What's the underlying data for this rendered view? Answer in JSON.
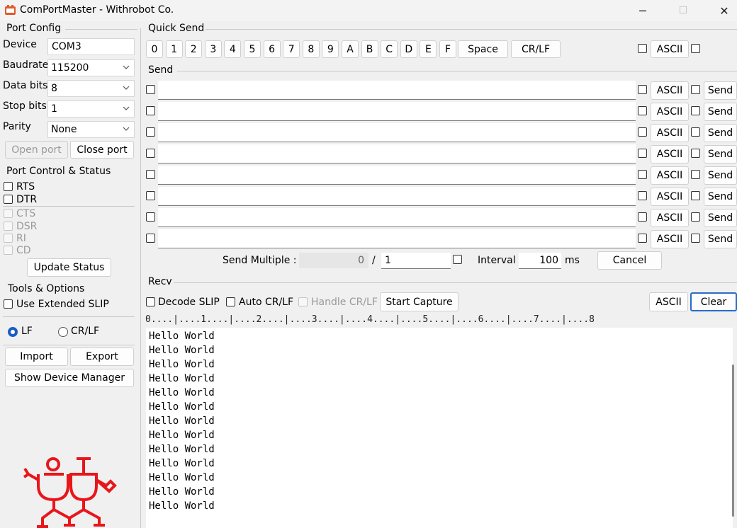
{
  "window": {
    "title": "ComPortMaster - Withrobot Co.",
    "buttons": {
      "minimize": "─",
      "maximize": "☐",
      "close": "✕"
    }
  },
  "port_config": {
    "title": "Port Config",
    "device_label": "Device",
    "device_value": "COM3",
    "baud_label": "Baudrate",
    "baud_value": "115200",
    "databits_label": "Data bits",
    "databits_value": "8",
    "stopbits_label": "Stop bits",
    "stopbits_value": "1",
    "parity_label": "Parity",
    "parity_value": "None",
    "open_label": "Open port",
    "close_label": "Close port"
  },
  "port_control": {
    "title": "Port Control & Status",
    "rts": "RTS",
    "dtr": "DTR",
    "cts": "CTS",
    "dsr": "DSR",
    "ri": "RI",
    "cd": "CD",
    "update": "Update Status"
  },
  "tools": {
    "title": "Tools & Options",
    "extended_slip": "Use Extended SLIP",
    "lf": "LF",
    "crlf": "CR/LF",
    "line_ending": "LF",
    "import": "Import",
    "export": "Export",
    "device_manager": "Show Device Manager"
  },
  "quick_send": {
    "title": "Quick Send",
    "keys": [
      "0",
      "1",
      "2",
      "3",
      "4",
      "5",
      "6",
      "7",
      "8",
      "9",
      "A",
      "B",
      "C",
      "D",
      "E",
      "F"
    ],
    "space": "Space",
    "crlf": "CR/LF",
    "ascii": "ASCII"
  },
  "send": {
    "title": "Send",
    "rows": [
      {
        "value": "",
        "ascii": "ASCII",
        "send": "Send"
      },
      {
        "value": "",
        "ascii": "ASCII",
        "send": "Send"
      },
      {
        "value": "",
        "ascii": "ASCII",
        "send": "Send"
      },
      {
        "value": "",
        "ascii": "ASCII",
        "send": "Send"
      },
      {
        "value": "",
        "ascii": "ASCII",
        "send": "Send"
      },
      {
        "value": "",
        "ascii": "ASCII",
        "send": "Send"
      },
      {
        "value": "",
        "ascii": "ASCII",
        "send": "Send"
      },
      {
        "value": "",
        "ascii": "ASCII",
        "send": "Send"
      }
    ],
    "multiple_label": "Send Multiple :",
    "multiple_count": "0",
    "slash": "/",
    "multiple_total": "1",
    "interval_label": "Interval",
    "interval_value": "100",
    "interval_unit": "ms",
    "cancel": "Cancel"
  },
  "recv": {
    "title": "Recv",
    "decode_slip": "Decode SLIP",
    "auto_crlf": "Auto CR/LF",
    "handle_crlf": "Handle CR/LF",
    "start_capture": "Start Capture",
    "ascii": "ASCII",
    "clear": "Clear",
    "ruler": "0....|....1....|....2....|....3....|....4....|....5....|....6....|....7....|....8",
    "lines": [
      "Hello World",
      "Hello World",
      "Hello World",
      "Hello World",
      "Hello World",
      "Hello World",
      "Hello World",
      "Hello World",
      "Hello World",
      "Hello World",
      "Hello World",
      "Hello World",
      "Hello World"
    ]
  },
  "colors": {
    "accent": "#1a5dc7",
    "logo": "#e8161b"
  },
  "icons": [
    "app-icon",
    "minimize-icon",
    "maximize-icon",
    "close-icon",
    "chevron-down-icon",
    "withrobot-logo"
  ]
}
